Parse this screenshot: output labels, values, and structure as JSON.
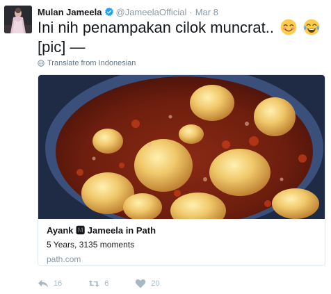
{
  "tweet": {
    "display_name": "Mulan Jameela",
    "handle": "@JameelaOfficial",
    "separator": "·",
    "time": "Mar 8",
    "text_line1": "Ini nih penampakan cilok muncrat..",
    "text_line2": "[pic] —",
    "translate_label": "Translate from Indonesian"
  },
  "icons": {
    "verified": "verified-badge-icon",
    "emoji1": "smiling-face-with-smiling-eyes-emoji",
    "emoji2": "face-with-tears-of-joy-emoji",
    "globe": "globe-icon",
    "reply": "reply-icon",
    "retweet": "retweet-icon",
    "like": "heart-icon"
  },
  "card": {
    "title": "Ayank 🅼 Jameela in Path",
    "description": "5 Years, 3135 moments",
    "domain": "path.com"
  },
  "actions": {
    "reply_count": "16",
    "retweet_count": "6",
    "like_count": "20"
  },
  "colors": {
    "verified_blue": "#1da1f2",
    "muted_text": "#8899a6",
    "action_gray": "#aab8c2",
    "border": "#e1e8ed"
  }
}
